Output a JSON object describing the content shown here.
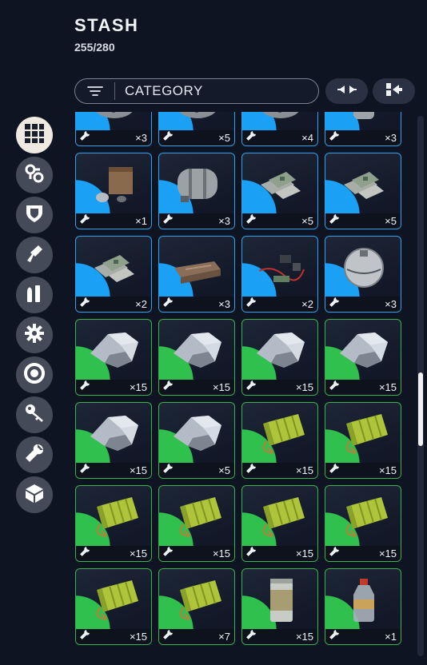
{
  "stash": {
    "title": "STASH",
    "capacity": "255/280"
  },
  "filter": {
    "label": "CATEGORY",
    "icon": "filter-icon"
  },
  "toolbar": {
    "collapse_icon": "collapse-arrows-icon",
    "sort_icon": "sort-merge-icon"
  },
  "sidebar": {
    "items": [
      {
        "name": "all-items",
        "icon": "grid-icon",
        "active": true
      },
      {
        "name": "attachments",
        "icon": "mods-icon",
        "active": false
      },
      {
        "name": "shields",
        "icon": "shield-icon",
        "active": false
      },
      {
        "name": "weapons",
        "icon": "gun-icon",
        "active": false
      },
      {
        "name": "ammo",
        "icon": "ammo-icon",
        "active": false
      },
      {
        "name": "components",
        "icon": "gear-icon",
        "active": false
      },
      {
        "name": "augments",
        "icon": "ring-icon",
        "active": false
      },
      {
        "name": "keys",
        "icon": "key-icon",
        "active": false
      },
      {
        "name": "materials",
        "icon": "wrench-icon",
        "active": false
      },
      {
        "name": "misc",
        "icon": "box-icon",
        "active": false
      }
    ]
  },
  "colors": {
    "rare": "#1aa0f4",
    "uncommon": "#2fc04e",
    "background": "#0f1422"
  },
  "slots": [
    {
      "rarity": "rare",
      "art": "mechanical-parts",
      "qty": "×3"
    },
    {
      "rarity": "rare",
      "art": "mechanical-parts",
      "qty": "×5"
    },
    {
      "rarity": "rare",
      "art": "mechanical-parts",
      "qty": "×4"
    },
    {
      "rarity": "rare",
      "art": "canister",
      "qty": "×3"
    },
    {
      "rarity": "rare",
      "art": "crate-and-parts",
      "qty": "×1"
    },
    {
      "rarity": "rare",
      "art": "barrel",
      "qty": "×3"
    },
    {
      "rarity": "rare",
      "art": "circuit-boards",
      "qty": "×5"
    },
    {
      "rarity": "rare",
      "art": "circuit-boards",
      "qty": "×5"
    },
    {
      "rarity": "rare",
      "art": "circuit-boards",
      "qty": "×2"
    },
    {
      "rarity": "rare",
      "art": "metal-case",
      "qty": "×3"
    },
    {
      "rarity": "rare",
      "art": "wires-parts",
      "qty": "×2"
    },
    {
      "rarity": "rare",
      "art": "sphere-device",
      "qty": "×3"
    },
    {
      "rarity": "uncommon",
      "art": "metal-scrap",
      "qty": "×15"
    },
    {
      "rarity": "uncommon",
      "art": "metal-scrap",
      "qty": "×15"
    },
    {
      "rarity": "uncommon",
      "art": "metal-scrap",
      "qty": "×15"
    },
    {
      "rarity": "uncommon",
      "art": "metal-scrap",
      "qty": "×15"
    },
    {
      "rarity": "uncommon",
      "art": "metal-scrap",
      "qty": "×15"
    },
    {
      "rarity": "uncommon",
      "art": "metal-scrap",
      "qty": "×5"
    },
    {
      "rarity": "uncommon",
      "art": "battery-pack",
      "qty": "×15"
    },
    {
      "rarity": "uncommon",
      "art": "battery-pack",
      "qty": "×15"
    },
    {
      "rarity": "uncommon",
      "art": "battery-pack",
      "qty": "×15"
    },
    {
      "rarity": "uncommon",
      "art": "battery-pack",
      "qty": "×15"
    },
    {
      "rarity": "uncommon",
      "art": "battery-pack",
      "qty": "×15"
    },
    {
      "rarity": "uncommon",
      "art": "battery-pack",
      "qty": "×15"
    },
    {
      "rarity": "uncommon",
      "art": "battery-pack",
      "qty": "×15"
    },
    {
      "rarity": "uncommon",
      "art": "battery-pack",
      "qty": "×7"
    },
    {
      "rarity": "uncommon",
      "art": "tin-can",
      "qty": "×15"
    },
    {
      "rarity": "uncommon",
      "art": "bottle",
      "qty": "×1"
    }
  ],
  "scroll": {
    "position": 0.55
  }
}
